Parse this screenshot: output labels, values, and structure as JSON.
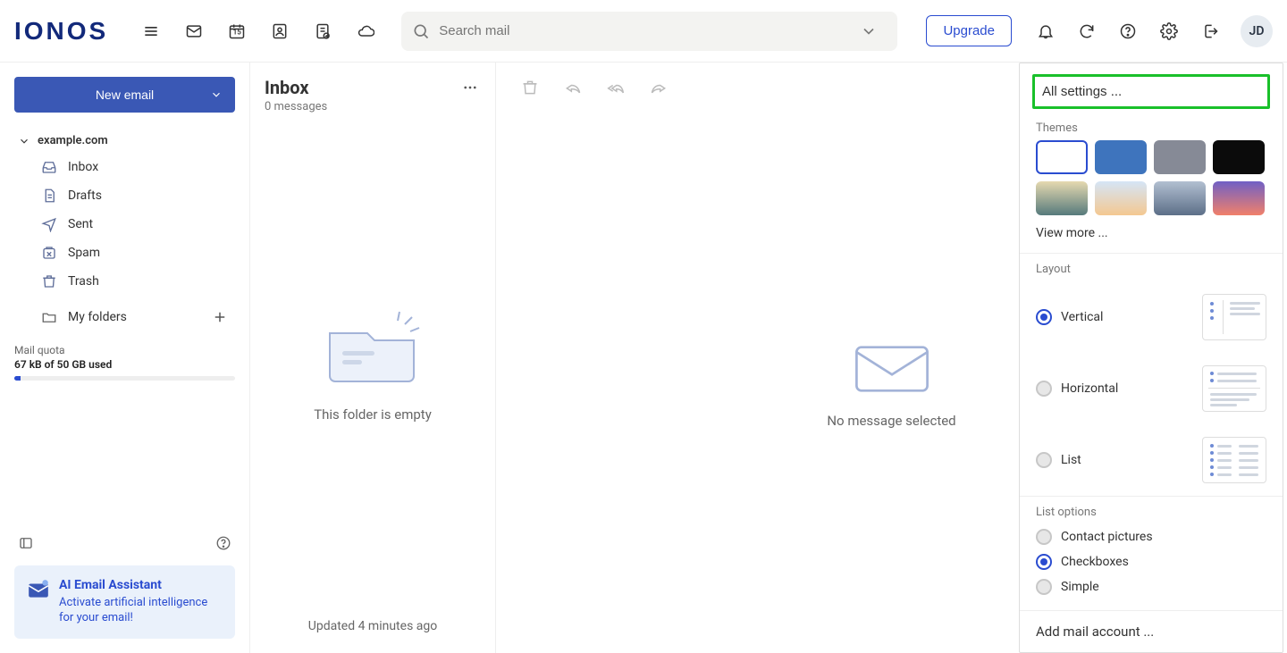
{
  "header": {
    "logo_text": "IONOS",
    "calendar_day": "15",
    "search_placeholder": "Search mail",
    "upgrade_label": "Upgrade",
    "avatar_initials": "JD"
  },
  "sidebar": {
    "new_email_label": "New email",
    "account_name": "example.com",
    "folders": {
      "inbox": "Inbox",
      "drafts": "Drafts",
      "sent": "Sent",
      "spam": "Spam",
      "trash": "Trash",
      "my_folders": "My folders"
    },
    "quota": {
      "label": "Mail quota",
      "text": "67 kB of 50 GB used"
    },
    "ai_card": {
      "title": "AI Email Assistant",
      "subtitle": "Activate artificial intelligence for your email!"
    }
  },
  "msglist": {
    "folder_title": "Inbox",
    "count_text": "0 messages",
    "empty_text": "This folder is empty",
    "updated_text": "Updated 4 minutes ago"
  },
  "reader": {
    "empty_text": "No message selected"
  },
  "settings_popover": {
    "all_settings_label": "All settings ...",
    "themes_label": "Themes",
    "view_more_label": "View more ...",
    "layout_label": "Layout",
    "layout_options": {
      "vertical": "Vertical",
      "horizontal": "Horizontal",
      "list": "List"
    },
    "list_options_label": "List options",
    "list_options": {
      "contact_pictures": "Contact pictures",
      "checkboxes": "Checkboxes",
      "simple": "Simple"
    },
    "add_mail_label": "Add mail account ..."
  },
  "themes": {
    "blue": "#3e74bd",
    "grey": "#868a96",
    "black": "#0b0b0b",
    "photo1": "linear-gradient(#e6d9b0,#567a7c)",
    "photo2": "linear-gradient(#d5e5f6,#f4c891)",
    "city": "linear-gradient(#b2bfd1,#5c6f88)",
    "sunset": "linear-gradient(#7060c5,#f1806a)"
  }
}
